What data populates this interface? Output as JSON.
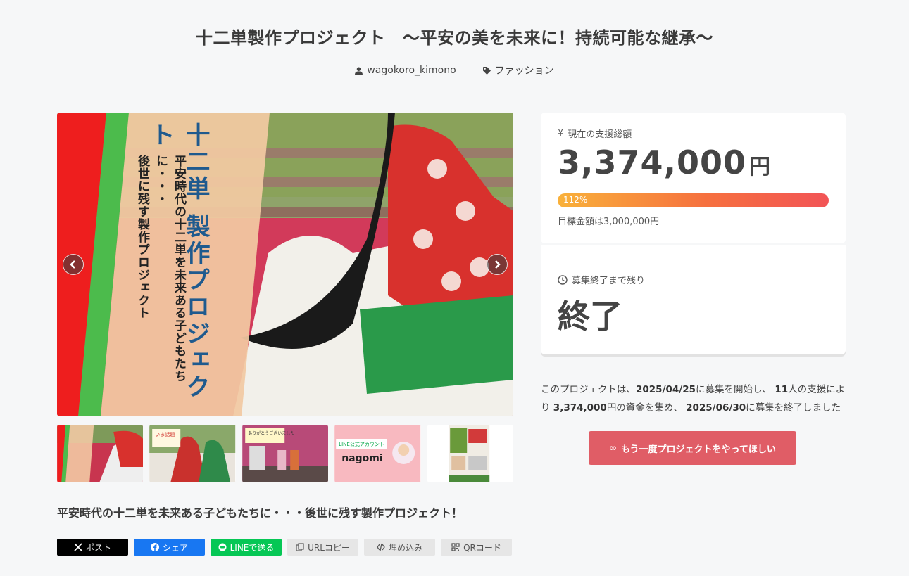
{
  "page": {
    "title": "十二単製作プロジェクト　～平安の美を未来に！持続可能な継承～",
    "author": "wagokoro_kimono",
    "category": "ファッション"
  },
  "hero": {
    "vertical_title": "十二単 製作プロジェクト",
    "vertical_sub_line1": "平安時代の十二単を未来ある子どもたちに・・・",
    "vertical_sub_line2": "後世に残す製作プロジェクト"
  },
  "thumbs": {
    "t2_caption": "いま話題",
    "t3_caption": "ありがとうございました",
    "t4_title": "LINE公式アカウント",
    "t4_name": "nagomi"
  },
  "summary": "平安時代の十二単を未来ある子どもたちに・・・後世に残す製作プロジェクト！",
  "share": {
    "x_label": "ポスト",
    "fb_label": "シェア",
    "line_label": "LINEで送る",
    "url_label": "URLコピー",
    "embed_label": "埋め込み",
    "qr_label": "QRコード"
  },
  "funding": {
    "label": "現在の支援総額",
    "amount": "3,374,000",
    "unit": "円",
    "progress_label": "112%",
    "progress_percent": 112,
    "goal": "目標金額は3,000,000円"
  },
  "remaining": {
    "label": "募集終了まで残り",
    "value": "終了"
  },
  "description": {
    "p1": "このプロジェクトは、",
    "start_date": "2025/04/25",
    "p2": "に募集を開始し、",
    "supporters": "11",
    "p3": "人の支援により",
    "raised": "3,374,000",
    "p4": "円の資金を集め、",
    "end_date": "2025/06/30",
    "p5": "に募集を終了しました"
  },
  "again_button": "もう一度プロジェクトをやってほしい",
  "colors": {
    "accent_button": "#e05d66",
    "bar_start": "#f9b13a",
    "bar_end": "#f25456"
  }
}
